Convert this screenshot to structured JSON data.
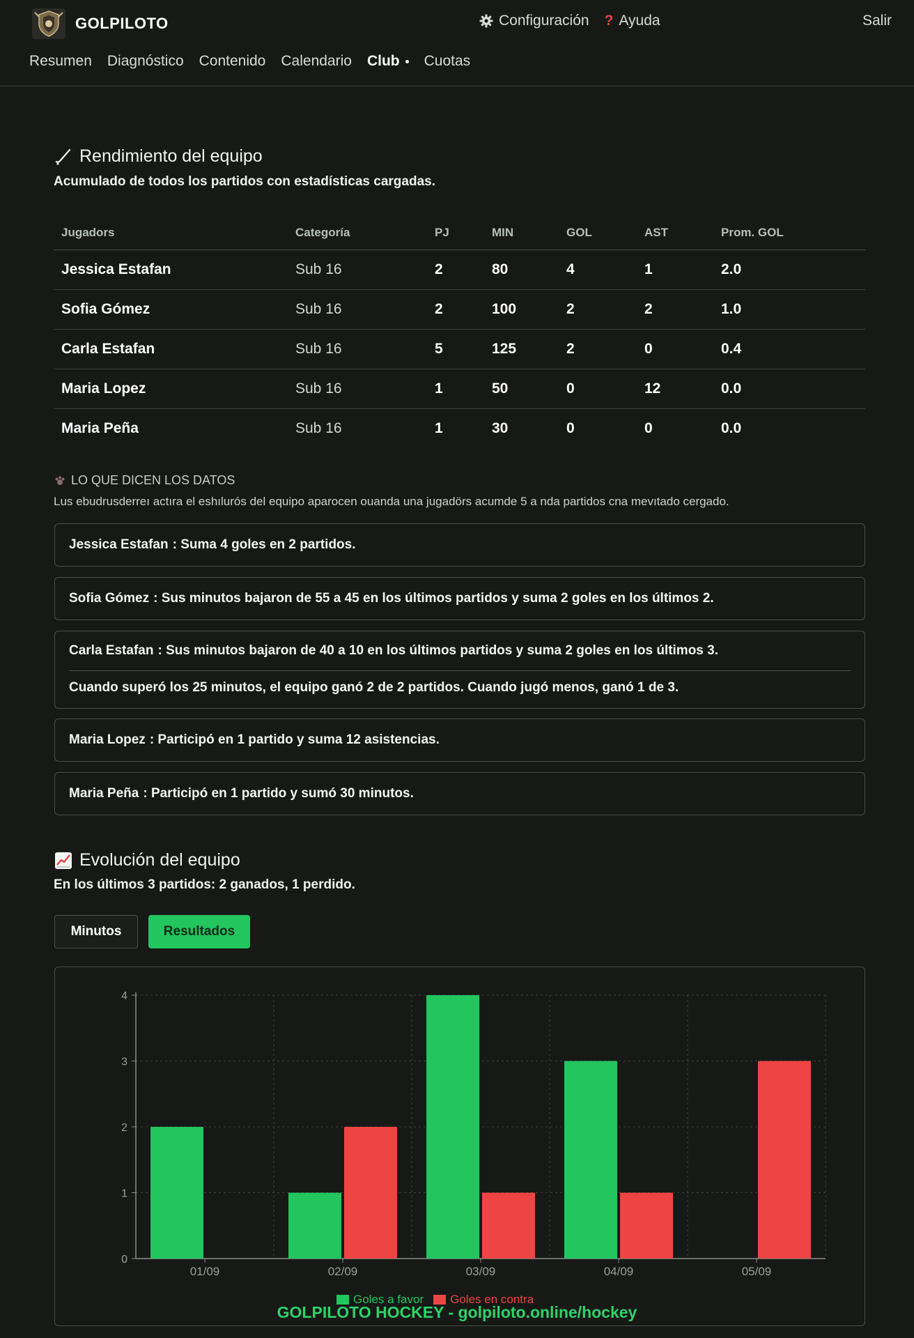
{
  "app": {
    "name": "GOLPILOTO"
  },
  "header": {
    "settings_label": "Configuración",
    "help_label": "Ayuda",
    "logout_label": "Salir"
  },
  "nav": {
    "items": [
      {
        "label": "Resumen"
      },
      {
        "label": "Diagnóstico"
      },
      {
        "label": "Contenido"
      },
      {
        "label": "Calendario"
      },
      {
        "label": "Club"
      },
      {
        "label": "Cuotas"
      }
    ],
    "active": "Club"
  },
  "performance": {
    "title": "Rendimiento del equipo",
    "subtitle": "Acumulado de todos los partidos con estadísticas cargadas.",
    "columns": [
      "Jugadors",
      "Categoría",
      "PJ",
      "MIN",
      "GOL",
      "AST",
      "Prom. GOL"
    ],
    "rows": [
      [
        "Jessica Estafan",
        "Sub 16",
        "2",
        "80",
        "4",
        "1",
        "2.0"
      ],
      [
        "Sofia Gómez",
        "Sub 16",
        "2",
        "100",
        "2",
        "2",
        "1.0"
      ],
      [
        "Carla Estafan",
        "Sub 16",
        "5",
        "125",
        "2",
        "0",
        "0.4"
      ],
      [
        "Maria Lopez",
        "Sub 16",
        "1",
        "50",
        "0",
        "12",
        "0.0"
      ],
      [
        "Maria Peña",
        "Sub 16",
        "1",
        "30",
        "0",
        "0",
        "0.0"
      ]
    ]
  },
  "insights": {
    "title": "LO QUE DICEN LOS DATOS",
    "note": "Lus ebudrusderreı actıra el eshılurós del equipo aparocen ouanda una jugadörs acumde 5 a nda partidos cna mevıtado cergado.",
    "cards": [
      {
        "player": "Jessica Estafan",
        "lines": [
          "Suma 4 goles en 2 partidos."
        ]
      },
      {
        "player": "Sofia Gómez",
        "lines": [
          "Sus minutos bajaron de 55 a 45 en los últimos partidos y suma 2 goles en los últimos 2."
        ]
      },
      {
        "player": "Carla Estafan",
        "lines": [
          "Sus minutos bajaron de 40 a 10 en los últimos partidos y suma 2 goles en los últimos 3.",
          "Cuando superó los 25 minutos, el equipo ganó 2 de 2 partidos. Cuando jugó menos, ganó 1 de 3."
        ]
      },
      {
        "player": "Maria Lopez",
        "lines": [
          "Participó en 1 partido y suma 12 asistencias."
        ]
      },
      {
        "player": "Maria Peña",
        "lines": [
          "Participó en 1 partido y sumó 30 minutos."
        ]
      }
    ]
  },
  "evolution": {
    "title": "Evolución del equipo",
    "subtitle": "En los últimos 3 partidos: 2 ganados, 1 perdido.",
    "toggle_minutes": "Minutos",
    "toggle_results": "Resultados",
    "active_toggle": "Resultados"
  },
  "chart_data": {
    "type": "bar",
    "categories": [
      "01/09",
      "02/09",
      "03/09",
      "04/09",
      "05/09"
    ],
    "series": [
      {
        "name": "Goles a favor",
        "values": [
          2,
          1,
          4,
          3,
          0
        ],
        "color": "#22c55e"
      },
      {
        "name": "Goles en contra",
        "values": [
          0,
          2,
          1,
          1,
          3
        ],
        "color": "#ef4444"
      }
    ],
    "ylim": [
      0,
      4
    ],
    "yticks": [
      "0",
      "1",
      "2",
      "3",
      "4"
    ],
    "grid": true,
    "legend": "bottom"
  },
  "footer": {
    "text": "GOLPILOTO HOCKEY - golpiloto.online/hockey"
  },
  "colors": {
    "accent": "#22c55e",
    "danger": "#ef4444",
    "background": "#161916"
  }
}
